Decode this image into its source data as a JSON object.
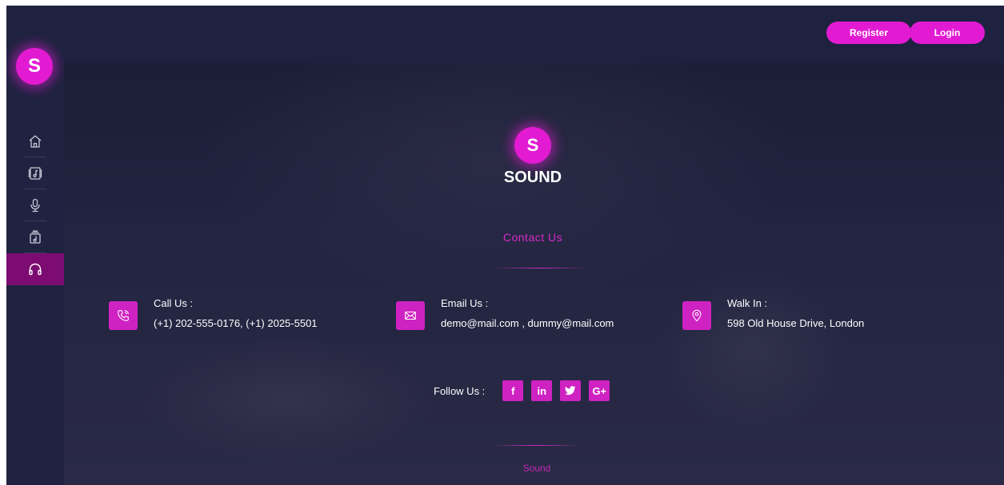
{
  "header": {
    "register_label": "Register",
    "login_label": "Login"
  },
  "sidebar": {
    "logo_letter": "S",
    "items": [
      {
        "name": "home",
        "icon": "home-icon"
      },
      {
        "name": "music-album",
        "icon": "music-album-icon"
      },
      {
        "name": "microphone",
        "icon": "microphone-icon"
      },
      {
        "name": "playlist",
        "icon": "playlist-icon"
      },
      {
        "name": "headphones",
        "icon": "headphones-icon",
        "active": true
      }
    ],
    "toggle_icon": "chevron-right-icon"
  },
  "brand": {
    "letter": "S",
    "name": "SOUND"
  },
  "contact": {
    "title": "Contact Us",
    "items": [
      {
        "icon": "phone-icon",
        "label": "Call Us :",
        "value": "(+1) 202-555-0176, (+1) 2025-5501"
      },
      {
        "icon": "mail-icon",
        "label": "Email Us :",
        "value": "demo@mail.com , dummy@mail.com"
      },
      {
        "icon": "location-icon",
        "label": "Walk In :",
        "value": "598 Old House Drive, London"
      }
    ]
  },
  "follow": {
    "label": "Follow Us :",
    "social": [
      {
        "name": "facebook",
        "glyph": "f"
      },
      {
        "name": "linkedin",
        "glyph": "in"
      },
      {
        "name": "twitter",
        "glyph": "t"
      },
      {
        "name": "google-plus",
        "glyph": "G+"
      }
    ]
  },
  "footer": {
    "text": "Sound"
  },
  "colors": {
    "accent": "#e21bd2",
    "background": "#1c1f38",
    "sidebar": "#1f2240",
    "active_item": "#7d0c72"
  }
}
